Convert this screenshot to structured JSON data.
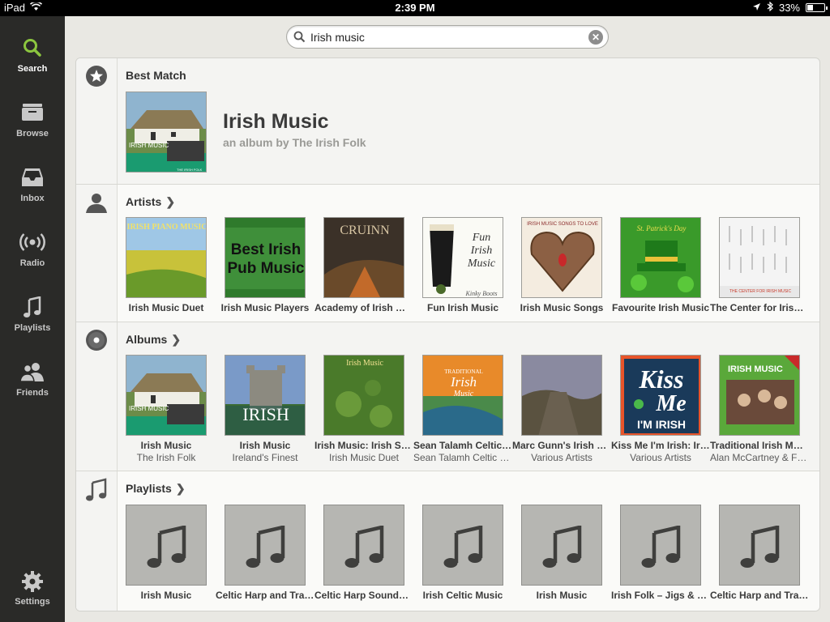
{
  "status": {
    "device": "iPad",
    "time": "2:39 PM",
    "battery": "33%",
    "battery_level": 0.33
  },
  "sidebar": {
    "items": [
      {
        "label": "Search",
        "icon": "search-icon"
      },
      {
        "label": "Browse",
        "icon": "folder-icon"
      },
      {
        "label": "Inbox",
        "icon": "inbox-icon"
      },
      {
        "label": "Radio",
        "icon": "radio-icon"
      },
      {
        "label": "Playlists",
        "icon": "music-note-icon"
      },
      {
        "label": "Friends",
        "icon": "friends-icon"
      },
      {
        "label": "Settings",
        "icon": "gear-icon"
      }
    ],
    "active_color": "#8cc63f"
  },
  "search": {
    "value": "Irish music"
  },
  "best_match": {
    "header": "Best Match",
    "title": "Irish Music",
    "subtitle": "an album by The Irish Folk"
  },
  "artists": {
    "header": "Artists",
    "items": [
      {
        "name": "Irish Music Duet"
      },
      {
        "name": "Irish Music Players"
      },
      {
        "name": "Academy of Irish Music"
      },
      {
        "name": "Fun Irish Music"
      },
      {
        "name": "Irish Music Songs"
      },
      {
        "name": "Favourite Irish Music"
      },
      {
        "name": "The Center for Irish Music"
      }
    ]
  },
  "albums": {
    "header": "Albums",
    "items": [
      {
        "name": "Irish Music",
        "artist": "The Irish Folk"
      },
      {
        "name": "Irish Music",
        "artist": "Ireland's Finest"
      },
      {
        "name": "Irish Music: Irish Songs",
        "artist": "Irish Music Duet"
      },
      {
        "name": "Sean Talamh Celtic Music",
        "artist": "Sean Talamh Celtic Music"
      },
      {
        "name": "Marc Gunn's Irish Music",
        "artist": "Various Artists"
      },
      {
        "name": "Kiss Me I'm Irish: Irish Music",
        "artist": "Various Artists"
      },
      {
        "name": "Traditional Irish Music",
        "artist": "Alan McCartney & Friends"
      }
    ]
  },
  "playlists": {
    "header": "Playlists",
    "items": [
      {
        "name": "Irish Music"
      },
      {
        "name": "Celtic Harp and Traditional"
      },
      {
        "name": "Celtic Harp Sounds of Ireland"
      },
      {
        "name": "Irish Celtic Music"
      },
      {
        "name": "Irish Music"
      },
      {
        "name": "Irish Folk – Jigs & Reels"
      },
      {
        "name": "Celtic Harp and Traditional"
      }
    ]
  },
  "cover_text": {
    "best": "IRISH MUSIC",
    "best_small": "THE IRISH FOLK",
    "artist_1": "IRISH PIANO MUSIC",
    "artist_2a": "Best Irish",
    "artist_2b": "Pub Music",
    "artist_3": "CRUINN",
    "artist_4a": "Fun",
    "artist_4b": "Irish",
    "artist_4c": "Music",
    "artist_4d": "Kinky Boots",
    "artist_5": "IRISH MUSIC SONGS TO LOVE",
    "artist_6": "St. Patrick's Day",
    "artist_7": "THE CENTER FOR IRISH MUSIC",
    "album_2": "IRISH",
    "album_3": "Irish Music",
    "album_4a": "TRADITIONAL",
    "album_4b": "Irish",
    "album_4c": "Music",
    "album_6a": "Kiss",
    "album_6b": "Me",
    "album_6c": "I'M IRISH",
    "album_7": "IRISH MUSIC"
  }
}
